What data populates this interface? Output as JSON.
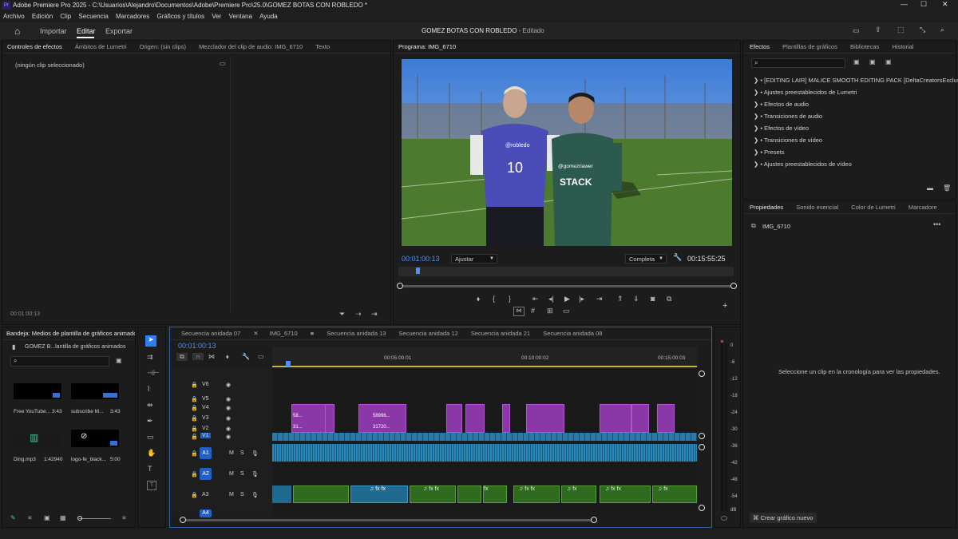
{
  "window": {
    "title": "Adobe Premiere Pro 2025 - C:\\Usuarios\\Alejandro\\Documentos\\Adobe\\Premiere Pro\\25.0\\GOMEZ BOTAS CON ROBLEDO *"
  },
  "menu": [
    "Archivo",
    "Edición",
    "Clip",
    "Secuencia",
    "Marcadores",
    "Gráficos y títulos",
    "Ver",
    "Ventana",
    "Ayuda"
  ],
  "workspace": {
    "tabs": [
      "Importar",
      "Editar",
      "Exportar"
    ],
    "active": "Editar",
    "project_title": "GOMEZ BOTAS CON ROBLEDO",
    "status": "- Editado"
  },
  "source_panel": {
    "tabs": [
      "Controles de efectos",
      "Ámbitos de Lumetri",
      "Origen: (sin clips)",
      "Mezclador del clip de audio: IMG_6710",
      "Texto"
    ],
    "no_clip": "(ningún clip seleccionado)",
    "timecode": "00:01:00:13"
  },
  "program": {
    "tab": "Programa: IMG_6710",
    "timecode": "00:01:00:13",
    "fit": "Ajustar",
    "quality": "Completa",
    "duration": "00:15:55:25",
    "frame": {
      "shirt_left_brand": "@robledo",
      "shirt_left_number": "10",
      "shirt_right_brand": "@gomezriawer",
      "shirt_right_logo": "STACK"
    }
  },
  "effects": {
    "tabs": [
      "Efectos",
      "Plantillas de gráficos",
      "Bibliotecas",
      "Historial"
    ],
    "items": [
      "[EDITING LAIR] MALICE SMOOTH EDITING PACK [DeltaCreatorsExclusive]",
      "Ajustes preestablecidos de Lumetri",
      "Efectos de audio",
      "Transiciones de audio",
      "Efectos de vídeo",
      "Transiciones de vídeo",
      "Presets",
      "Ajustes preestablecidos de vídeo"
    ]
  },
  "properties": {
    "tabs": [
      "Propiedades",
      "Sonido esencial",
      "Color de Lumetri",
      "Marcadore"
    ],
    "clip": "IMG_6710",
    "hint": "Seleccione un clip en la cronología para ver las propiedades.",
    "create_button": "Crear gráfico nuevo"
  },
  "bin": {
    "tab": "Bandeja: Medios de plantilla de gráficos animado",
    "folder": "GOMEZ B...lantilla de gráficos animados",
    "items": [
      {
        "name": "Free YouTube...",
        "dur": "3:43"
      },
      {
        "name": "subscribe M...",
        "dur": "3:43"
      },
      {
        "name": "Ding.mp3",
        "dur": "1:42940"
      },
      {
        "name": "logo-fe_black...",
        "dur": "5:00"
      }
    ]
  },
  "timeline": {
    "tabs": [
      "Secuencia anidada 07",
      "IMG_6710",
      "Secuencia anidada 13",
      "Secuencia anidada 12",
      "Secuencia anidada 21",
      "Secuencia anidada 08"
    ],
    "active": "IMG_6710",
    "timecode": "00:01:00:13",
    "ruler": [
      "00:05:00:01",
      "00:10:00:02",
      "00:15:00:03"
    ],
    "video_tracks": [
      "V6",
      "V5",
      "V4",
      "V3",
      "V2",
      "V1"
    ],
    "audio_tracks": [
      "A1",
      "A2",
      "A3",
      "A4"
    ],
    "clip_labels": {
      "v3a": "58...",
      "v3b": "58996...",
      "v2a": "31...",
      "v2b": "31720..."
    },
    "track_buttons": [
      "M",
      "S"
    ]
  },
  "meter": {
    "ticks": [
      "0",
      "-6",
      "-12",
      "-18",
      "-24",
      "-30",
      "-36",
      "-42",
      "-48",
      "-54",
      "dB"
    ]
  },
  "colors": {
    "accent": "#2f7df6",
    "video_clip": "#8a38a8",
    "audio_clip": "#1f6a8e",
    "green_clip": "#2f6a1f"
  }
}
